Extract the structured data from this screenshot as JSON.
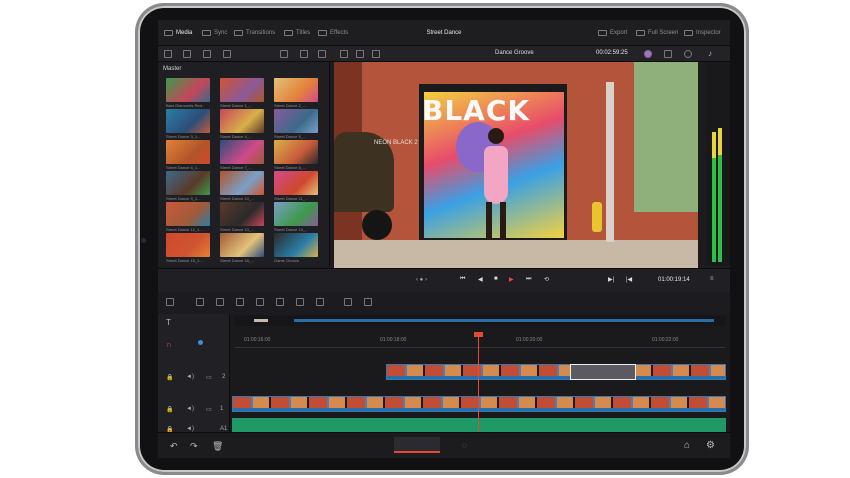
{
  "topbar": {
    "tabs": [
      "Media",
      "Sync",
      "Transitions",
      "Titles",
      "Effects"
    ],
    "project": "Street Dance",
    "right": [
      "Export",
      "Full Screen",
      "Inspector"
    ]
  },
  "toolbar": {
    "timeline_name": "Dance Groove",
    "timecode": "00:02:59:25"
  },
  "media": {
    "folder": "Master",
    "clips": [
      "Bars Diamonds Red..",
      "Street Dance 1_...",
      "Street Dance 2_...",
      "Street Dance 3_1...",
      "Street Dance 4_...",
      "Street Dance 5_...",
      "Street Dance 6_1...",
      "Street Dance 7_...",
      "Street Dance 8_...",
      "Street Dance 9_1...",
      "Street Dance 10_...",
      "Street Dance 11_...",
      "Street Dance 12_1...",
      "Street Dance 13_...",
      "Street Dance 14_...",
      "Street Dance 15_1...",
      "Street Dance 16_...",
      "Game Groove"
    ]
  },
  "viewer": {
    "sign_top": "BLACK",
    "sign_small": "NEON BLACK 2"
  },
  "transport": {
    "timecode": "01:00:19:14"
  },
  "ruler": {
    "marks": [
      "01:00:16:00",
      "01:00:18:00",
      "01:00:20:00",
      "01:00:22:00"
    ]
  },
  "tracks": {
    "labels": [
      "2",
      "1",
      "A1"
    ]
  }
}
